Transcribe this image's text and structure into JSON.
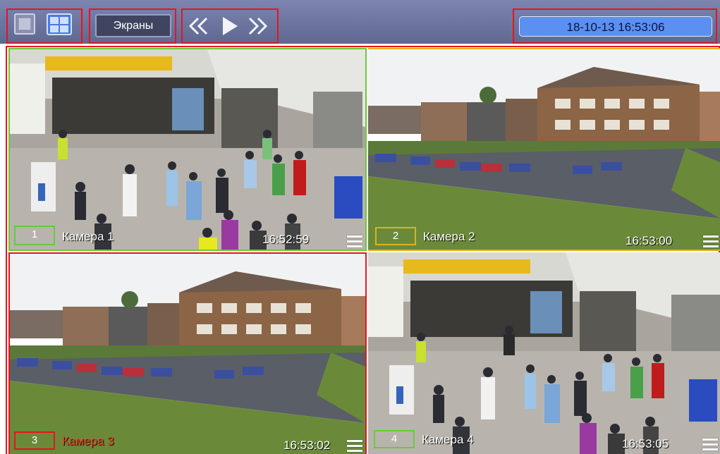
{
  "toolbar": {
    "screens_label": "Экраны",
    "datetime": "18-10-13   16:53:06",
    "layout_single_icon": "single-view-icon",
    "layout_grid_icon": "grid-2x2-icon",
    "prev_icon": "rewind-icon",
    "play_icon": "play-icon",
    "next_icon": "fast-forward-icon"
  },
  "cameras": [
    {
      "number": "1",
      "name": "Камера 1",
      "time": "16:52:59",
      "frame_color": "#66cc33"
    },
    {
      "number": "2",
      "name": "Камера 2",
      "time": "16:53:00",
      "frame_color": "#e0b020"
    },
    {
      "number": "3",
      "name": "Камера 3",
      "time": "16:53:02",
      "frame_color": "#e8141c"
    },
    {
      "number": "4",
      "name": "Камера 4",
      "time": "16:53:05",
      "frame_color": "#66cc33"
    }
  ],
  "colors": {
    "toolbar": "#6b739c",
    "highlight": "#e8141c",
    "date_box": "#5b8ff0"
  }
}
